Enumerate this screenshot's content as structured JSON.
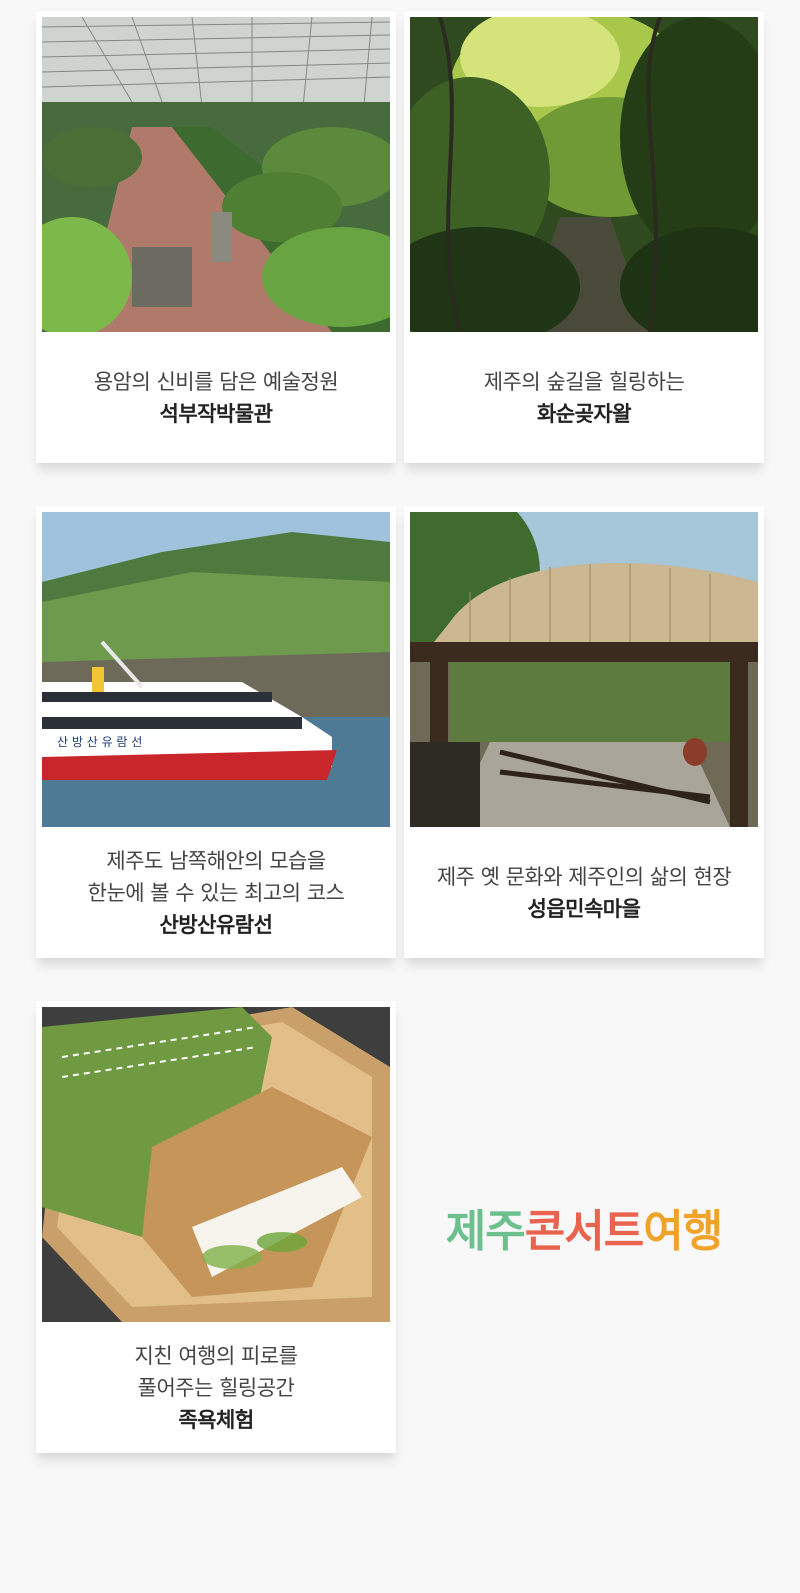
{
  "cards": [
    {
      "sub_lines": [
        "용암의 신비를 담은 예술정원"
      ],
      "name": "석부작박물관"
    },
    {
      "sub_lines": [
        "제주의 숲길을 힐링하는"
      ],
      "name": "화순곶자왈"
    },
    {
      "sub_lines": [
        "제주도 남쪽해안의 모습을",
        "한눈에 볼 수 있는 최고의 코스"
      ],
      "name": "산방산유람선"
    },
    {
      "sub_lines": [
        "제주 옛 문화와 제주인의 삶의 현장"
      ],
      "name": "성읍민속마을"
    },
    {
      "sub_lines": [
        "지친 여행의 피로를",
        "풀어주는 힐링공간"
      ],
      "name": "족욕체험"
    }
  ],
  "boat_sign": "산 방 산 유 람 선",
  "brand": {
    "part1": "제주",
    "part2": "콘서트",
    "part3": "여행",
    "color1": "#6cc08e",
    "color2": "#e9634f",
    "color3": "#f0a32b"
  },
  "icons": [
    "greenhouse-photo",
    "forest-photo",
    "ferry-photo",
    "thatched-gate-photo",
    "footbath-kit-photo"
  ]
}
